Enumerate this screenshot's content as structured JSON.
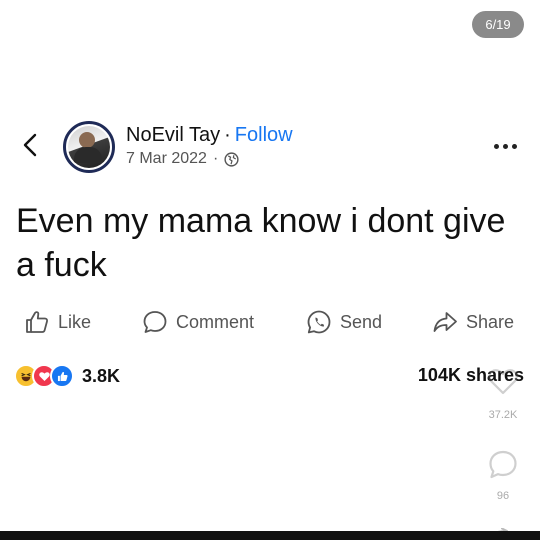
{
  "viewer": {
    "counter": "6/19"
  },
  "post": {
    "author": "NoEvil Tay",
    "separator": "·",
    "follow_label": "Follow",
    "date": "7 Mar 2022",
    "meta_separator": "·",
    "audience_icon": "globe-icon",
    "text": "Even my mama know i dont give a fuck"
  },
  "actions": {
    "like": "Like",
    "comment": "Comment",
    "send": "Send",
    "share": "Share"
  },
  "engagement": {
    "reaction_icons": [
      "haha-reaction-icon",
      "love-reaction-icon",
      "like-reaction-icon"
    ],
    "reaction_count": "3.8K",
    "shares": "104K shares"
  },
  "side_panel": {
    "likes": "37.2K",
    "comments": "96"
  },
  "colors": {
    "link": "#1877f2",
    "avatar_ring": "#1f2b57",
    "text": "#111111",
    "muted": "#555555"
  }
}
